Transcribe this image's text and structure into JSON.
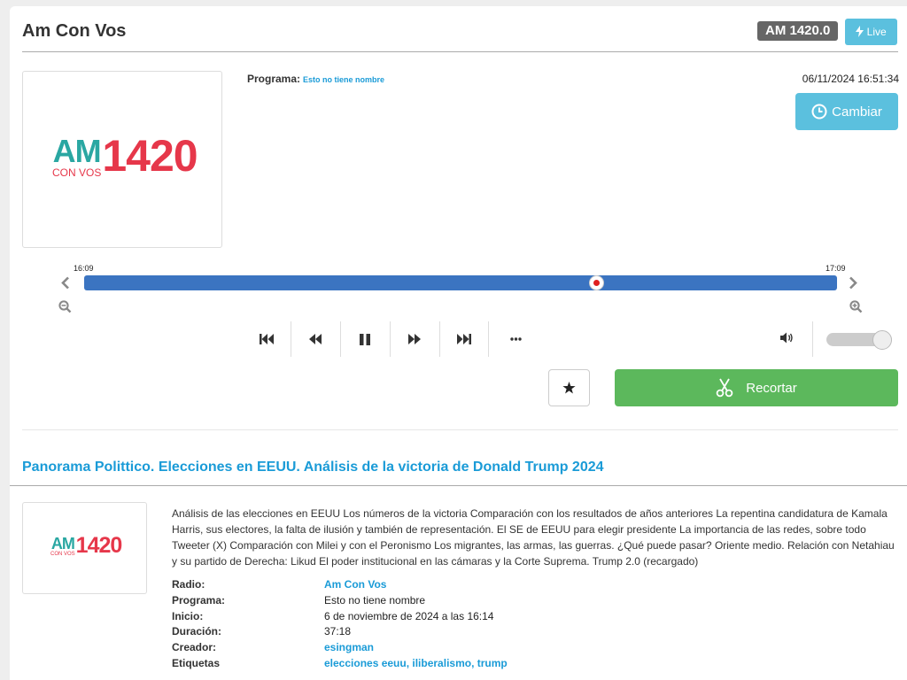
{
  "header": {
    "title": "Am Con Vos",
    "station_badge": "AM 1420.0",
    "live_label": "Live"
  },
  "player": {
    "logo": {
      "am": "AM",
      "con_vos": "CON VOS",
      "number": "1420"
    },
    "programa_label": "Programa:",
    "programa_value": "Esto no tiene nombre",
    "datetime": "06/11/2024 16:51:34",
    "cambiar_label": "Cambiar",
    "timeline": {
      "start": "16:09",
      "end": "17:09",
      "position_fraction": 0.68
    },
    "volume_fraction": 0.85,
    "recortar_label": "Recortar"
  },
  "episode": {
    "title": "Panorama Polittico. Elecciones en EEUU. Análisis de la victoria de Donald Trump 2024",
    "description": "Análisis de las elecciones en EEUU Los números de la victoria Comparación con los resultados de años anteriores La repentina candidatura de Kamala Harris, sus electores, la falta de ilusión y también de representación. El SE de EEUU para elegir presidente La importancia de las redes, sobre todo Tweeter (X) Comparación con Milei y con el Peronismo Los migrantes, las armas, las guerras. ¿Qué puede pasar? Oriente medio. Relación con Netahiau y su partido de Derecha: Likud El poder institucional en las cámaras y la Corte Suprema. Trump 2.0 (recargado)",
    "meta": [
      {
        "label": "Radio:",
        "value": "Am Con Vos",
        "link": true
      },
      {
        "label": "Programa:",
        "value": "Esto no tiene nombre",
        "link": false
      },
      {
        "label": "Inicio:",
        "value": "6 de noviembre de 2024 a las 16:14",
        "link": false
      },
      {
        "label": "Duración:",
        "value": "37:18",
        "link": false
      },
      {
        "label": "Creador:",
        "value": "esingman",
        "link": true
      },
      {
        "label": "Etiquetas",
        "value": "elecciones eeuu, iliberalismo, trump",
        "link": true
      }
    ]
  },
  "icons": {
    "live": "bolt-icon",
    "cambiar": "clock-icon",
    "timeline_prev": "chevron-left-icon",
    "timeline_next": "chevron-right-icon",
    "zoom_out": "zoom-out-icon",
    "zoom_in": "zoom-in-icon",
    "controls": [
      "skip-start-icon",
      "rewind-icon",
      "pause-icon",
      "fast-forward-icon",
      "skip-end-icon",
      "more-icon"
    ],
    "volume": "volume-icon",
    "star": "star-icon",
    "recortar": "scissors-icon"
  },
  "colors": {
    "accent": "#5bc0de",
    "link": "#1a9bd7",
    "success": "#5cb85c",
    "timeline": "#3b74c1",
    "logo_teal": "#2aa7a2",
    "logo_red": "#e6374a"
  }
}
